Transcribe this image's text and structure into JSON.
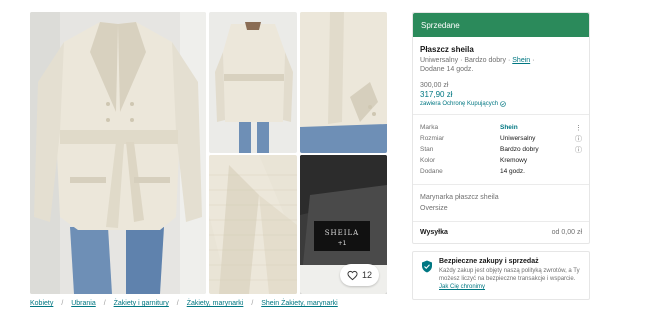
{
  "gallery": {
    "favourite_count": "12",
    "label_tag_text": "SHEILA",
    "label_tag_sub": "+1",
    "colors": {
      "coat": "#ece7da",
      "coat_shadow": "#d6cfbd",
      "jeans": "#6e8fb6",
      "wall": "#e9e9e7",
      "dark_fabric": "#3b3b3b"
    }
  },
  "breadcrumb": {
    "items": [
      "Kobiety",
      "Ubrania",
      "Żakiety i garnitury",
      "Żakiety, marynarki",
      "Shein Żakiety, marynarki"
    ],
    "separator": "/"
  },
  "listing": {
    "status_banner": "Sprzedane",
    "title": "Płaszcz sheila",
    "size": "Uniwersalny",
    "condition": "Bardzo dobry",
    "brand_link": "Shein",
    "dot": "·",
    "added": "Dodane 14 godz.",
    "price_old": "300,00 zł",
    "price_new": "317,90 zł",
    "protection": "zawiera Ochronę Kupujących",
    "details": [
      {
        "key": "Marka",
        "value": "Shein",
        "icon": "⋮",
        "link": true
      },
      {
        "key": "Rozmiar",
        "value": "Uniwersalny",
        "icon": "ⓘ",
        "link": false
      },
      {
        "key": "Stan",
        "value": "Bardzo dobry",
        "icon": "ⓘ",
        "link": false
      },
      {
        "key": "Kolor",
        "value": "Kremowy",
        "icon": "",
        "link": false
      },
      {
        "key": "Dodane",
        "value": "14 godz.",
        "icon": "",
        "link": false
      }
    ],
    "description": [
      "Marynarka płaszcz sheila",
      "Oversize"
    ],
    "shipping_label": "Wysyłka",
    "shipping_value": "od 0,00 zł",
    "accent_color": "#007782",
    "sold_color": "#2b8a5b"
  },
  "safety": {
    "title": "Bezpieczne zakupy i sprzedaż",
    "text": "Każdy zakup jest objęty naszą polityką zwrotów, a Ty możesz liczyć na bezpieczne transakcje i wsparcie.",
    "link": "Jak Cię chronimy"
  }
}
